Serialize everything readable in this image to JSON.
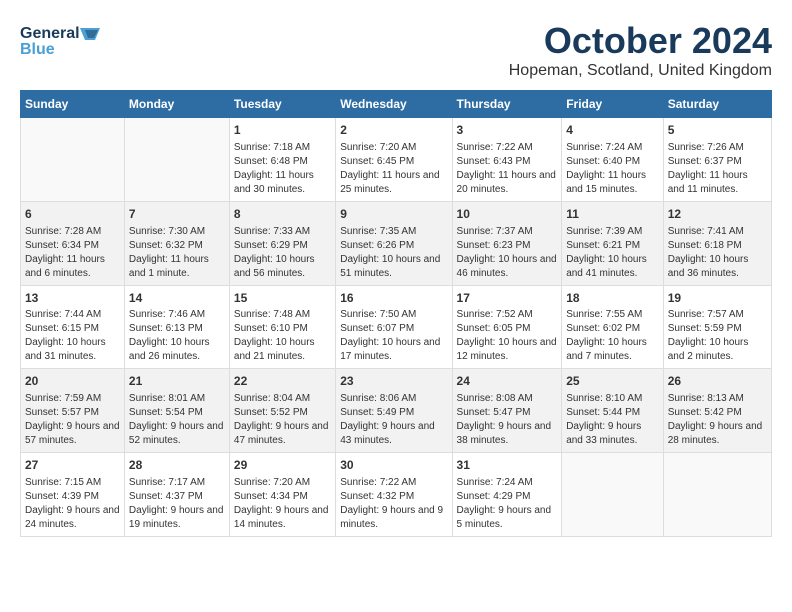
{
  "header": {
    "logo_line1": "General",
    "logo_line2": "Blue",
    "month": "October 2024",
    "location": "Hopeman, Scotland, United Kingdom"
  },
  "days_of_week": [
    "Sunday",
    "Monday",
    "Tuesday",
    "Wednesday",
    "Thursday",
    "Friday",
    "Saturday"
  ],
  "weeks": [
    [
      {
        "day": "",
        "sunrise": "",
        "sunset": "",
        "daylight": ""
      },
      {
        "day": "",
        "sunrise": "",
        "sunset": "",
        "daylight": ""
      },
      {
        "day": "1",
        "sunrise": "Sunrise: 7:18 AM",
        "sunset": "Sunset: 6:48 PM",
        "daylight": "Daylight: 11 hours and 30 minutes."
      },
      {
        "day": "2",
        "sunrise": "Sunrise: 7:20 AM",
        "sunset": "Sunset: 6:45 PM",
        "daylight": "Daylight: 11 hours and 25 minutes."
      },
      {
        "day": "3",
        "sunrise": "Sunrise: 7:22 AM",
        "sunset": "Sunset: 6:43 PM",
        "daylight": "Daylight: 11 hours and 20 minutes."
      },
      {
        "day": "4",
        "sunrise": "Sunrise: 7:24 AM",
        "sunset": "Sunset: 6:40 PM",
        "daylight": "Daylight: 11 hours and 15 minutes."
      },
      {
        "day": "5",
        "sunrise": "Sunrise: 7:26 AM",
        "sunset": "Sunset: 6:37 PM",
        "daylight": "Daylight: 11 hours and 11 minutes."
      }
    ],
    [
      {
        "day": "6",
        "sunrise": "Sunrise: 7:28 AM",
        "sunset": "Sunset: 6:34 PM",
        "daylight": "Daylight: 11 hours and 6 minutes."
      },
      {
        "day": "7",
        "sunrise": "Sunrise: 7:30 AM",
        "sunset": "Sunset: 6:32 PM",
        "daylight": "Daylight: 11 hours and 1 minute."
      },
      {
        "day": "8",
        "sunrise": "Sunrise: 7:33 AM",
        "sunset": "Sunset: 6:29 PM",
        "daylight": "Daylight: 10 hours and 56 minutes."
      },
      {
        "day": "9",
        "sunrise": "Sunrise: 7:35 AM",
        "sunset": "Sunset: 6:26 PM",
        "daylight": "Daylight: 10 hours and 51 minutes."
      },
      {
        "day": "10",
        "sunrise": "Sunrise: 7:37 AM",
        "sunset": "Sunset: 6:23 PM",
        "daylight": "Daylight: 10 hours and 46 minutes."
      },
      {
        "day": "11",
        "sunrise": "Sunrise: 7:39 AM",
        "sunset": "Sunset: 6:21 PM",
        "daylight": "Daylight: 10 hours and 41 minutes."
      },
      {
        "day": "12",
        "sunrise": "Sunrise: 7:41 AM",
        "sunset": "Sunset: 6:18 PM",
        "daylight": "Daylight: 10 hours and 36 minutes."
      }
    ],
    [
      {
        "day": "13",
        "sunrise": "Sunrise: 7:44 AM",
        "sunset": "Sunset: 6:15 PM",
        "daylight": "Daylight: 10 hours and 31 minutes."
      },
      {
        "day": "14",
        "sunrise": "Sunrise: 7:46 AM",
        "sunset": "Sunset: 6:13 PM",
        "daylight": "Daylight: 10 hours and 26 minutes."
      },
      {
        "day": "15",
        "sunrise": "Sunrise: 7:48 AM",
        "sunset": "Sunset: 6:10 PM",
        "daylight": "Daylight: 10 hours and 21 minutes."
      },
      {
        "day": "16",
        "sunrise": "Sunrise: 7:50 AM",
        "sunset": "Sunset: 6:07 PM",
        "daylight": "Daylight: 10 hours and 17 minutes."
      },
      {
        "day": "17",
        "sunrise": "Sunrise: 7:52 AM",
        "sunset": "Sunset: 6:05 PM",
        "daylight": "Daylight: 10 hours and 12 minutes."
      },
      {
        "day": "18",
        "sunrise": "Sunrise: 7:55 AM",
        "sunset": "Sunset: 6:02 PM",
        "daylight": "Daylight: 10 hours and 7 minutes."
      },
      {
        "day": "19",
        "sunrise": "Sunrise: 7:57 AM",
        "sunset": "Sunset: 5:59 PM",
        "daylight": "Daylight: 10 hours and 2 minutes."
      }
    ],
    [
      {
        "day": "20",
        "sunrise": "Sunrise: 7:59 AM",
        "sunset": "Sunset: 5:57 PM",
        "daylight": "Daylight: 9 hours and 57 minutes."
      },
      {
        "day": "21",
        "sunrise": "Sunrise: 8:01 AM",
        "sunset": "Sunset: 5:54 PM",
        "daylight": "Daylight: 9 hours and 52 minutes."
      },
      {
        "day": "22",
        "sunrise": "Sunrise: 8:04 AM",
        "sunset": "Sunset: 5:52 PM",
        "daylight": "Daylight: 9 hours and 47 minutes."
      },
      {
        "day": "23",
        "sunrise": "Sunrise: 8:06 AM",
        "sunset": "Sunset: 5:49 PM",
        "daylight": "Daylight: 9 hours and 43 minutes."
      },
      {
        "day": "24",
        "sunrise": "Sunrise: 8:08 AM",
        "sunset": "Sunset: 5:47 PM",
        "daylight": "Daylight: 9 hours and 38 minutes."
      },
      {
        "day": "25",
        "sunrise": "Sunrise: 8:10 AM",
        "sunset": "Sunset: 5:44 PM",
        "daylight": "Daylight: 9 hours and 33 minutes."
      },
      {
        "day": "26",
        "sunrise": "Sunrise: 8:13 AM",
        "sunset": "Sunset: 5:42 PM",
        "daylight": "Daylight: 9 hours and 28 minutes."
      }
    ],
    [
      {
        "day": "27",
        "sunrise": "Sunrise: 7:15 AM",
        "sunset": "Sunset: 4:39 PM",
        "daylight": "Daylight: 9 hours and 24 minutes."
      },
      {
        "day": "28",
        "sunrise": "Sunrise: 7:17 AM",
        "sunset": "Sunset: 4:37 PM",
        "daylight": "Daylight: 9 hours and 19 minutes."
      },
      {
        "day": "29",
        "sunrise": "Sunrise: 7:20 AM",
        "sunset": "Sunset: 4:34 PM",
        "daylight": "Daylight: 9 hours and 14 minutes."
      },
      {
        "day": "30",
        "sunrise": "Sunrise: 7:22 AM",
        "sunset": "Sunset: 4:32 PM",
        "daylight": "Daylight: 9 hours and 9 minutes."
      },
      {
        "day": "31",
        "sunrise": "Sunrise: 7:24 AM",
        "sunset": "Sunset: 4:29 PM",
        "daylight": "Daylight: 9 hours and 5 minutes."
      },
      {
        "day": "",
        "sunrise": "",
        "sunset": "",
        "daylight": ""
      },
      {
        "day": "",
        "sunrise": "",
        "sunset": "",
        "daylight": ""
      }
    ]
  ]
}
